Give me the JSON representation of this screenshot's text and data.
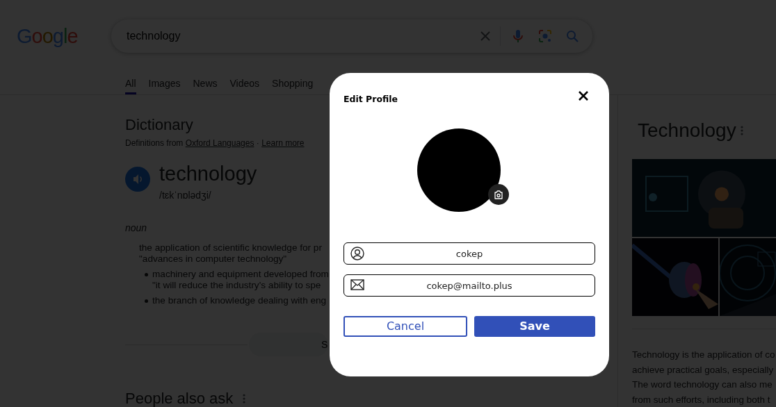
{
  "search": {
    "logo": "Google",
    "query": "technology"
  },
  "tabs": [
    {
      "label": "All",
      "selected": true
    },
    {
      "label": "Images",
      "selected": false
    },
    {
      "label": "News",
      "selected": false
    },
    {
      "label": "Videos",
      "selected": false
    },
    {
      "label": "Shopping",
      "selected": false
    }
  ],
  "dictionary": {
    "title": "Dictionary",
    "source_prefix": "Definitions from",
    "source_link": "Oxford Languages",
    "separator": "·",
    "learn_more": "Learn more",
    "word": "technology",
    "phonetic": "/tɛkˈnɒlədʒi/",
    "part_of_speech": "noun",
    "senses": [
      {
        "kind": "plain",
        "definition": "the application of scientific knowledge for pr",
        "example": "\"advances in computer technology\""
      },
      {
        "kind": "bullet",
        "definition": "machinery and equipment developed from",
        "example": "\"it will reduce the industry's ability to spe"
      },
      {
        "kind": "bullet",
        "definition": "the branch of knowledge dealing with eng"
      }
    ],
    "see_more": "S"
  },
  "people_also_ask": "People also ask",
  "knowledge_panel": {
    "title": "Technology",
    "images": [
      {
        "kind": "picture"
      },
      {
        "kind": "picture"
      },
      {
        "kind": "picture"
      }
    ],
    "description_lines": [
      "Technology is the application of co",
      "achieve practical goals, especially",
      "The word technology can also me",
      "from such efforts, including both t"
    ]
  },
  "modal": {
    "title": "Edit Profile",
    "fields": [
      {
        "kind": "user",
        "value": "cokep"
      },
      {
        "kind": "email",
        "value": "cokep@mailto.plus"
      }
    ],
    "buttons": [
      {
        "kind": "secondary",
        "label": "Cancel"
      },
      {
        "kind": "primary",
        "label": "Save"
      }
    ]
  }
}
